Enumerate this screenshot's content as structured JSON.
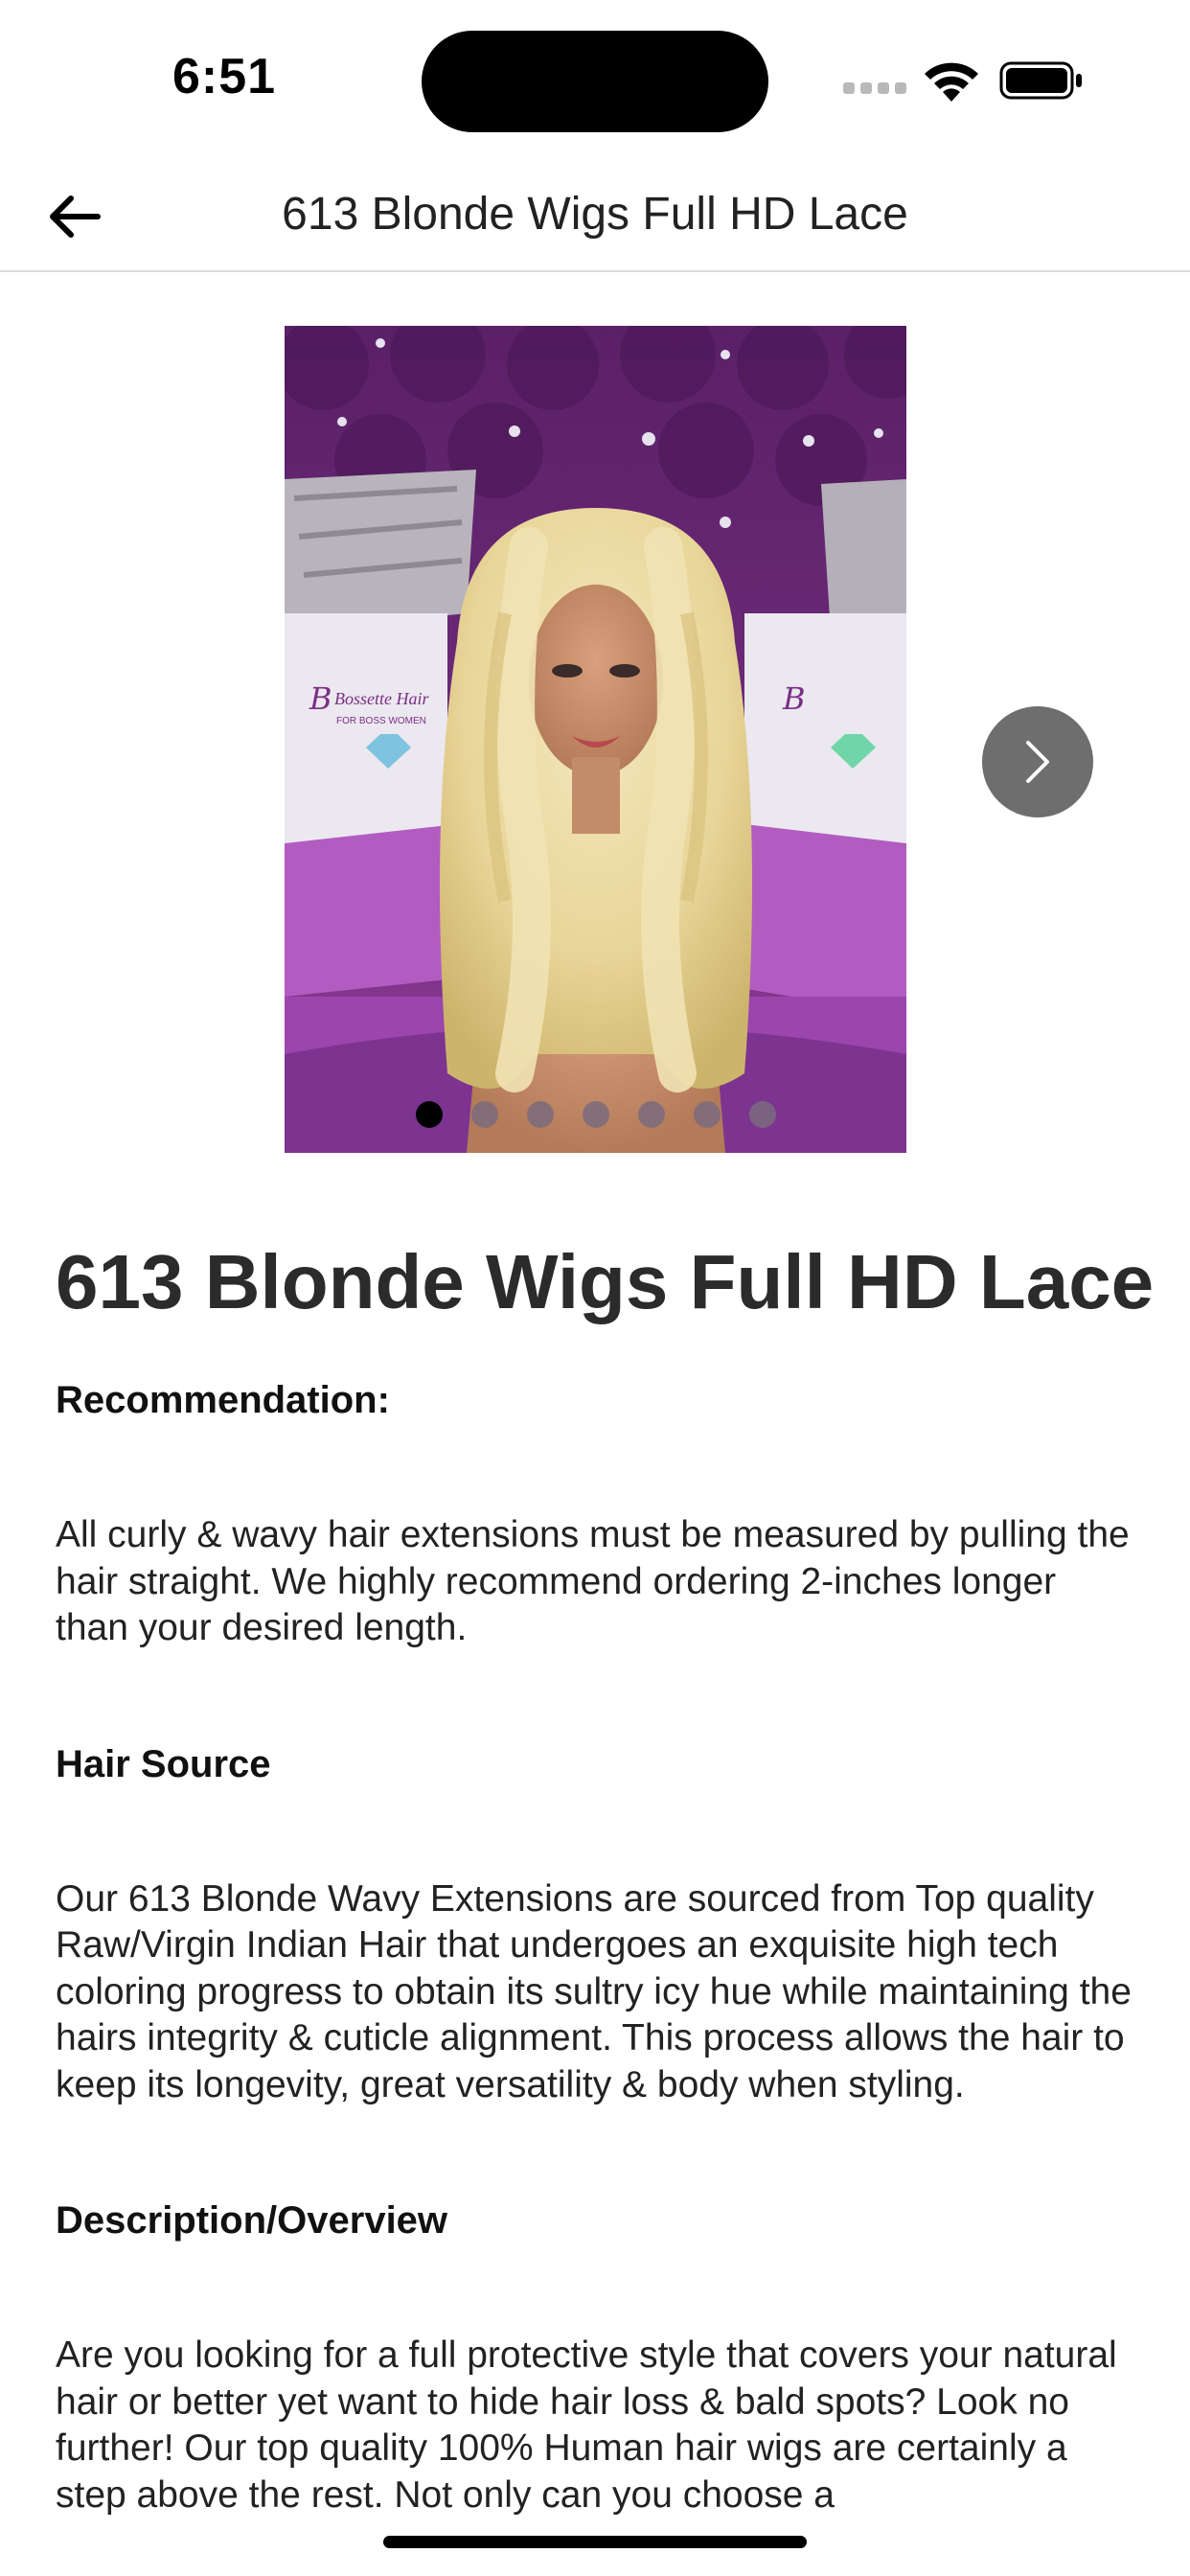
{
  "status_bar": {
    "time": "6:51"
  },
  "nav": {
    "title": "613 Blonde Wigs Full HD Lace",
    "back_icon": "arrow-left-icon"
  },
  "carousel": {
    "slide_count": 7,
    "active_slide": 1,
    "next_icon": "chevron-right-icon",
    "photo_brand_text": "Bossette Hair",
    "photo_brand_tagline": "FOR BOSS WOMEN"
  },
  "product": {
    "title": "613 Blonde Wigs Full HD Lace",
    "sections": [
      {
        "heading": "Recommendation:",
        "body": "All curly & wavy hair extensions must be measured by pulling the hair straight. We highly recommend ordering 2-inches longer than your desired length."
      },
      {
        "heading": "Hair Source",
        "body": "Our 613 Blonde Wavy Extensions are sourced from Top quality Raw/Virgin Indian Hair that undergoes an exquisite high tech coloring progress to obtain its sultry icy hue while maintaining the hairs integrity & cuticle alignment. This process allows the hair to keep its longevity, great versatility & body when styling."
      },
      {
        "heading": "Description/Overview",
        "body": "Are you looking for a full protective style that covers your natural hair or better yet want to hide hair loss & bald spots? Look no further! Our top quality 100% Human hair wigs are certainly a step above the rest. Not only can you choose a"
      }
    ]
  },
  "colors": {
    "background": "#ffffff",
    "text": "#222222",
    "next_button": "#6e6e6e",
    "purple_backdrop": "#7a2f86"
  }
}
